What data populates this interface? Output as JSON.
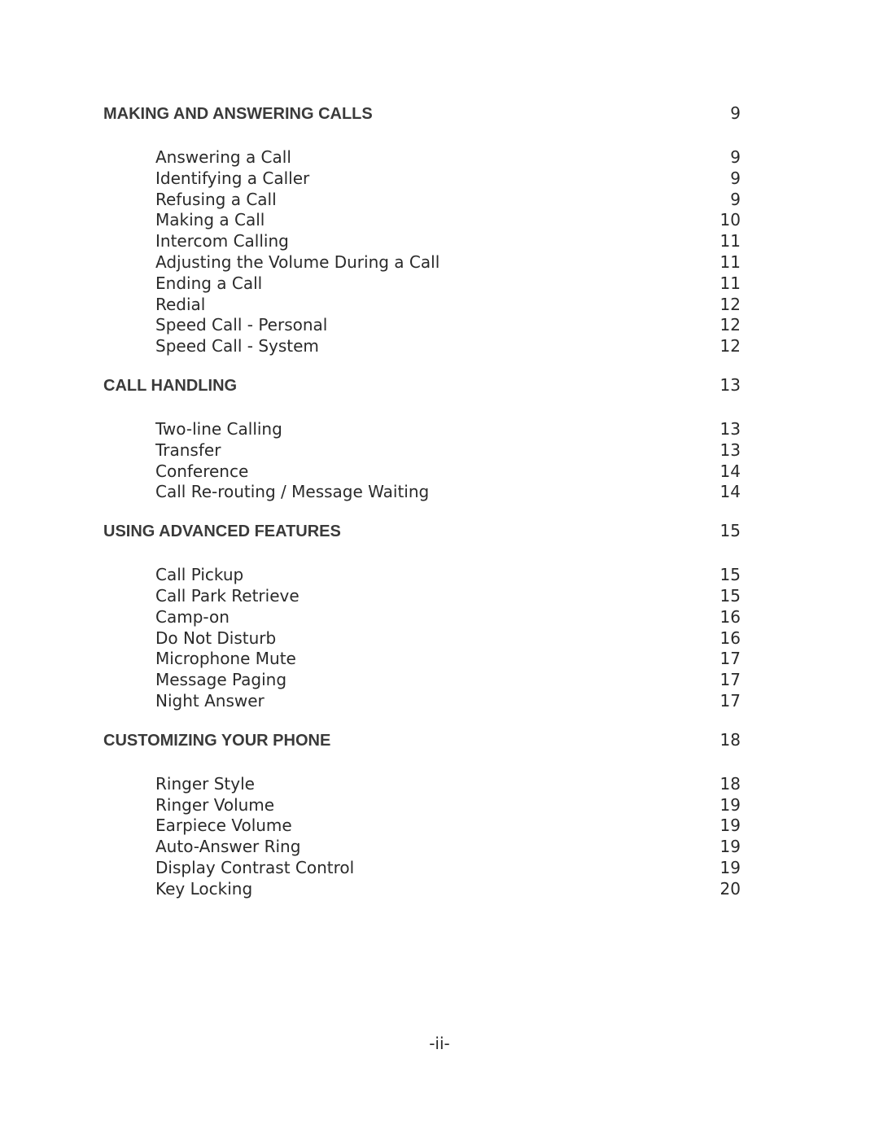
{
  "sections": [
    {
      "title": "MAKING AND ANSWERING CALLS",
      "page": "9",
      "entries": [
        {
          "label": "Answering a Call",
          "page": "9"
        },
        {
          "label": "Identifying a Caller",
          "page": "9"
        },
        {
          "label": "Refusing a Call",
          "page": "9"
        },
        {
          "label": "Making a Call",
          "page": "10"
        },
        {
          "label": "Intercom Calling",
          "page": "11"
        },
        {
          "label": "Adjusting the Volume During a Call",
          "page": "11"
        },
        {
          "label": "Ending a Call",
          "page": "11"
        },
        {
          "label": "Redial",
          "page": "12"
        },
        {
          "label": "Speed Call - Personal",
          "page": "12"
        },
        {
          "label": "Speed Call - System",
          "page": "12"
        }
      ]
    },
    {
      "title": "CALL HANDLING",
      "page": "13",
      "entries": [
        {
          "label": "Two-line Calling",
          "page": "13"
        },
        {
          "label": "Transfer",
          "page": "13"
        },
        {
          "label": "Conference",
          "page": "14"
        },
        {
          "label": "Call Re-routing / Message Waiting",
          "page": "14"
        }
      ]
    },
    {
      "title": "USING ADVANCED FEATURES",
      "page": "15",
      "entries": [
        {
          "label": "Call Pickup",
          "page": "15"
        },
        {
          "label": "Call Park Retrieve",
          "page": "15"
        },
        {
          "label": "Camp-on",
          "page": "16"
        },
        {
          "label": "Do Not Disturb",
          "page": "16"
        },
        {
          "label": "Microphone Mute",
          "page": "17"
        },
        {
          "label": "Message Paging",
          "page": "17"
        },
        {
          "label": "Night Answer",
          "page": "17"
        }
      ]
    },
    {
      "title": "CUSTOMIZING YOUR PHONE",
      "page": "18",
      "entries": [
        {
          "label": "Ringer Style",
          "page": "18"
        },
        {
          "label": "Ringer Volume",
          "page": "19"
        },
        {
          "label": "Earpiece Volume",
          "page": "19"
        },
        {
          "label": "Auto-Answer Ring",
          "page": "19"
        },
        {
          "label": "Display Contrast Control",
          "page": "19"
        },
        {
          "label": "Key Locking",
          "page": "20"
        }
      ]
    }
  ],
  "footer": {
    "page_number": "-ii-"
  }
}
